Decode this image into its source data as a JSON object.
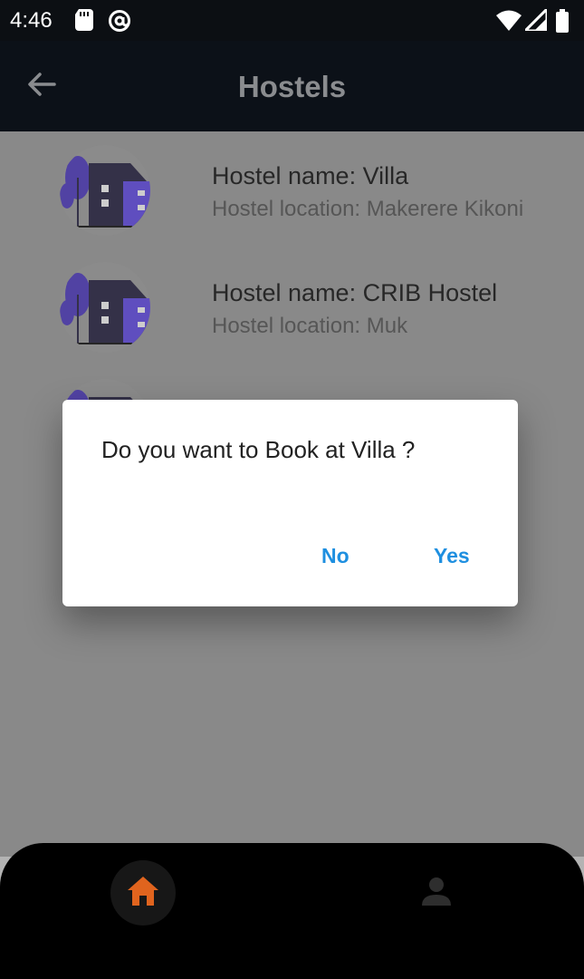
{
  "status_bar": {
    "time": "4:46",
    "icons": [
      "sd-card-icon",
      "at-sign-icon",
      "wifi-icon",
      "signal-icon",
      "battery-icon"
    ]
  },
  "app_bar": {
    "title": "Hostels",
    "back_icon": "arrow-left-icon"
  },
  "hostels": [
    {
      "name": "Hostel name: Villa",
      "location": "Hostel location: Makerere Kikoni"
    },
    {
      "name": "Hostel name: CRIB Hostel",
      "location": "Hostel location: Muk"
    }
  ],
  "dialog": {
    "message": "Do you want to Book at Villa ?",
    "no_label": "No",
    "yes_label": "Yes"
  },
  "bottom_nav": {
    "items": [
      {
        "icon": "home-icon",
        "active": true
      },
      {
        "icon": "person-icon",
        "active": false
      }
    ]
  },
  "colors": {
    "accent": "#1e8fe0",
    "home_active": "#e0641e",
    "app_bar": "#0c1118",
    "avatar_purple": "#5b47c8",
    "avatar_dark": "#2a2640"
  }
}
